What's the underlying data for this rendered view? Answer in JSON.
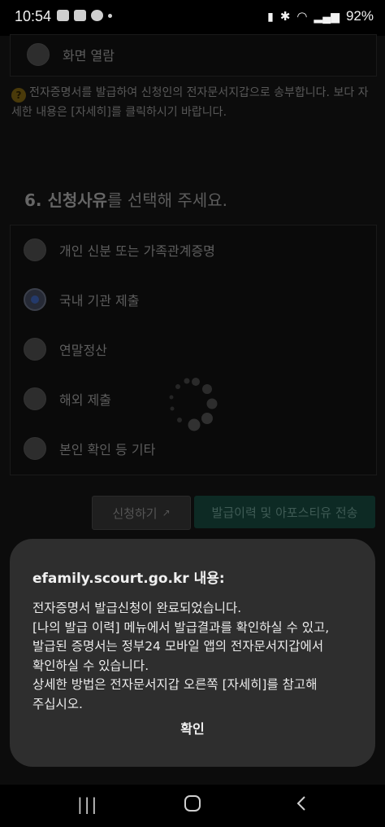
{
  "status_bar": {
    "time": "10:54",
    "battery": "92%"
  },
  "top_option": {
    "label": "화면 열람"
  },
  "notice": {
    "text": "전자증명서를 발급하여 신청인의 전자문서지갑으로 송부합니다. 보다 자세한 내용은 [자세히]를 클릭하시기 바랍니다."
  },
  "section6": {
    "title_number": "6. 신청사유",
    "title_rest": "를 선택해 주세요.",
    "options": [
      {
        "label": "개인 신분 또는 가족관계증명",
        "selected": false
      },
      {
        "label": "국내 기관 제출",
        "selected": true
      },
      {
        "label": "연말정산",
        "selected": false
      },
      {
        "label": "해외 제출",
        "selected": false
      },
      {
        "label": "본인 확인 등 기타",
        "selected": false
      }
    ]
  },
  "buttons": {
    "apply": "신청하기",
    "history": "발급이력 및 아포스티유 전송"
  },
  "dialog": {
    "title": "efamily.scourt.go.kr 내용:",
    "lines": [
      "전자증명서 발급신청이 완료되었습니다.",
      "[나의 발급 이력] 메뉴에서 발급결과를 확인하실 수 있고,",
      "발급된 증명서는 정부24 모바일 앱의 전자문서지갑에서",
      "확인하실 수 있습니다.",
      "상세한 방법은 전자문서지갑 오른쪽 [자세히]를 참고해",
      "주십시오."
    ],
    "ok": "확인"
  },
  "colors": {
    "accent_green": "#0d2a24",
    "dialog_bg": "#2e2e2e"
  }
}
